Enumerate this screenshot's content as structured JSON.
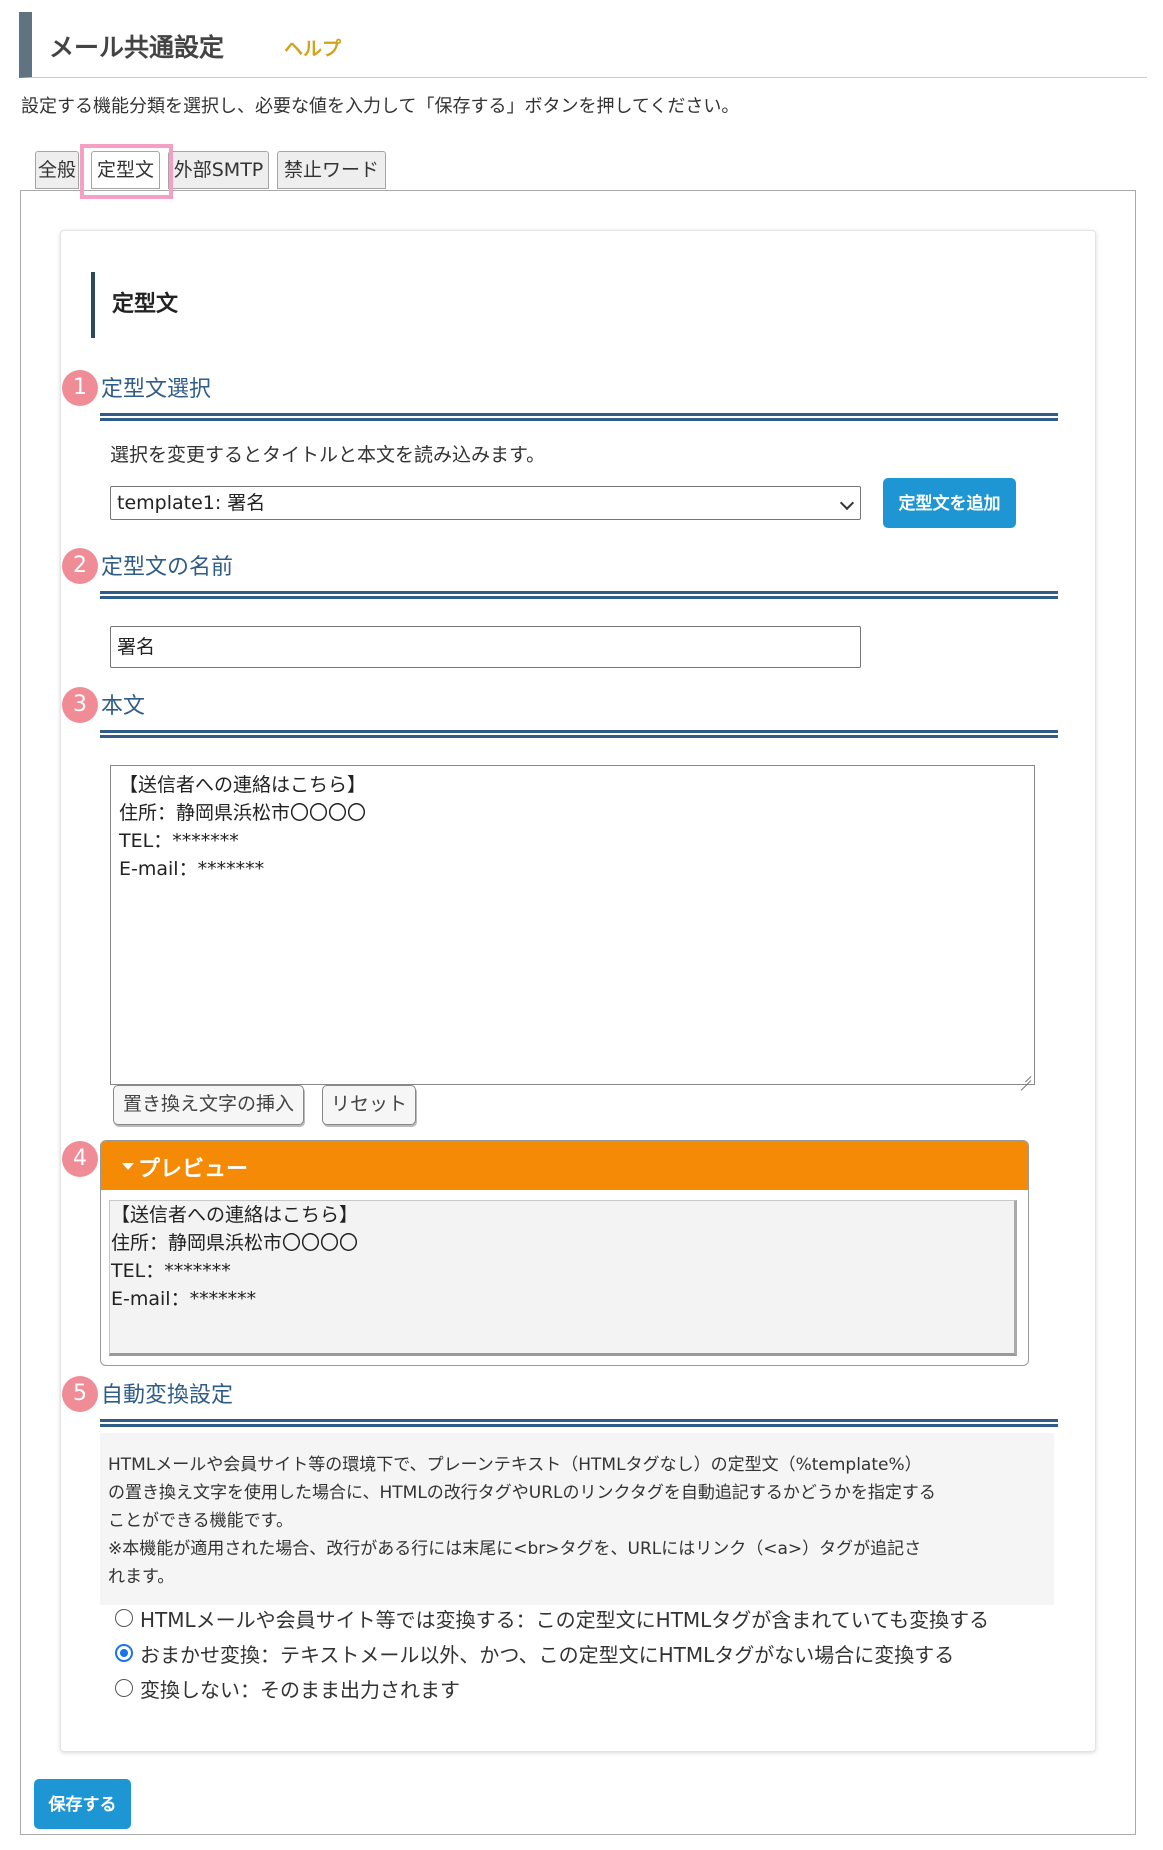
{
  "header": {
    "title": "メール共通設定",
    "help": "ヘルプ"
  },
  "intro": "設定する機能分類を選択し、必要な値を入力して「保存する」ボタンを押してください。",
  "tabs": [
    "全般",
    "定型文",
    "外部SMTP",
    "禁止ワード"
  ],
  "active_tab": "定型文",
  "card_title": "定型文",
  "sections": [
    {
      "num": "1",
      "label": "定型文選択"
    },
    {
      "num": "2",
      "label": "定型文の名前"
    },
    {
      "num": "3",
      "label": "本文"
    },
    {
      "num": "4"
    },
    {
      "num": "5",
      "label": "自動変換設定"
    }
  ],
  "select": {
    "hint": "選択を変更するとタイトルと本文を読み込みます。",
    "value": "template1: 署名",
    "add_button": "定型文を追加"
  },
  "name_value": "署名",
  "body": {
    "lines": [
      "【送信者への連絡はこちら】",
      "住所：静岡県浜松市〇〇〇〇",
      "TEL：*******",
      "E-mail：*******"
    ],
    "insert_button": "置き換え文字の挿入",
    "reset_button": "リセット"
  },
  "preview": {
    "label": "プレビュー",
    "lines": [
      "【送信者への連絡はこちら】",
      "住所：静岡県浜松市〇〇〇〇",
      "TEL：*******",
      "E-mail：*******"
    ]
  },
  "auto_convert": {
    "description": [
      "HTMLメールや会員サイト等の環境下で、プレーンテキスト（HTMLタグなし）の定型文（%template%）",
      "の置き換え文字を使用した場合に、HTMLの改行タグやURLのリンクタグを自動追記するかどうかを指定する",
      "ことができる機能です。",
      "※本機能が適用された場合、改行がある行には末尾に<br>タグを、URLにはリンク（<a>）タグが追記さ",
      "れます。"
    ],
    "options": [
      {
        "label": "HTMLメールや会員サイト等では変換する：この定型文にHTMLタグが含まれていても変換する",
        "checked": false
      },
      {
        "label": "おまかせ変換：テキストメール以外、かつ、この定型文にHTMLタグがない場合に変換する",
        "checked": true
      },
      {
        "label": "変換しない：そのまま出力されます",
        "checked": false
      }
    ]
  },
  "save_button": "保存する"
}
